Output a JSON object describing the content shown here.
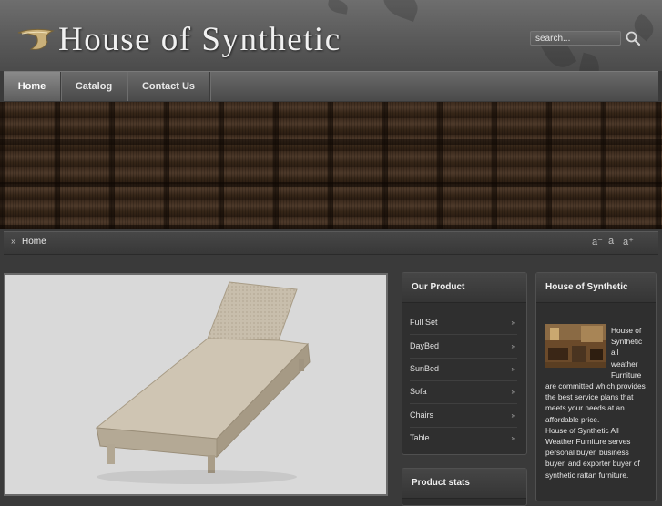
{
  "site": {
    "title": "House of Synthetic"
  },
  "search": {
    "placeholder": "search..."
  },
  "nav": {
    "items": [
      {
        "label": "Home"
      },
      {
        "label": "Catalog"
      },
      {
        "label": "Contact Us"
      }
    ]
  },
  "breadcrumb": {
    "label": "Home"
  },
  "font_size_controls": {
    "decrease": "a⁻",
    "reset": "a",
    "increase": "a⁺"
  },
  "our_product": {
    "title": "Our Product",
    "items": [
      {
        "label": "Full Set"
      },
      {
        "label": "DayBed"
      },
      {
        "label": "SunBed"
      },
      {
        "label": "Sofa"
      },
      {
        "label": "Chairs"
      },
      {
        "label": "Table"
      }
    ]
  },
  "product_stats": {
    "title": "Product stats"
  },
  "about": {
    "title": "House of Synthetic",
    "paragraph1": "House of Synthetic all weather Furniture are committed which provides the best service plans that meets your needs at an affordable price.",
    "paragraph2": "House of Synthetic All Weather Furniture serves personal buyer, business buyer, and exporter buyer of synthetic rattan furniture."
  },
  "colors": {
    "accent": "#d9d9d9",
    "panel": "#2f2f2f",
    "header": "#5a5a5a"
  },
  "icons": {
    "search": "search-icon",
    "arrow": "arrow-right-icon"
  }
}
